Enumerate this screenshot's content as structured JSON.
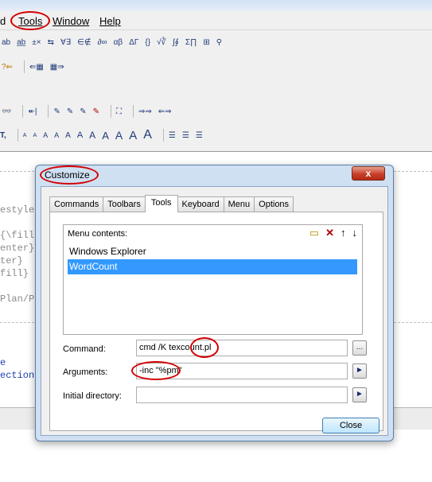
{
  "menubar": {
    "items": [
      {
        "name": "menu-edit-partial",
        "label": "d"
      },
      {
        "name": "menu-tools",
        "label": "Tools",
        "ul": "T"
      },
      {
        "name": "menu-window",
        "label": "Window",
        "ul": "W"
      },
      {
        "name": "menu-help",
        "label": "Help",
        "ul": "H"
      }
    ]
  },
  "toolbar": {
    "font_size_glyphs": [
      "A",
      "A",
      "A",
      "A",
      "A",
      "A",
      "A",
      "A",
      "A",
      "A",
      "A",
      "A"
    ],
    "font_prefix": "T,"
  },
  "editor": {
    "lines": [
      {
        "text": "estyle",
        "blue": false
      },
      {
        "text": "{\\fill",
        "blue": false
      },
      {
        "text": "enter}",
        "blue": false
      },
      {
        "text": "ter}",
        "blue": false
      },
      {
        "text": "fill}",
        "blue": false
      },
      {
        "text": "Plan/Pl",
        "blue": false
      },
      {
        "text": "e",
        "blue": true
      },
      {
        "text": "ection",
        "blue": true
      }
    ]
  },
  "dialog": {
    "title": "Customize",
    "close_glyph": "x",
    "tabs": [
      "Commands",
      "Toolbars",
      "Tools",
      "Keyboard",
      "Menu",
      "Options"
    ],
    "active_tab": "Tools",
    "menu_contents_label": "Menu contents:",
    "menu_contents_ul": "M",
    "tools": [
      "Windows Explorer",
      "WordCount"
    ],
    "selected_tool": "WordCount",
    "command_label": "Command:",
    "command_value": "cmd /K texcount.pl",
    "arguments_label": "Arguments:",
    "arguments_value": "-inc \"%pm\"",
    "initial_dir_label": "Initial directory:",
    "initial_dir_value": "",
    "browse_label": "...",
    "arrow_label": "►",
    "close_button": "Close"
  }
}
